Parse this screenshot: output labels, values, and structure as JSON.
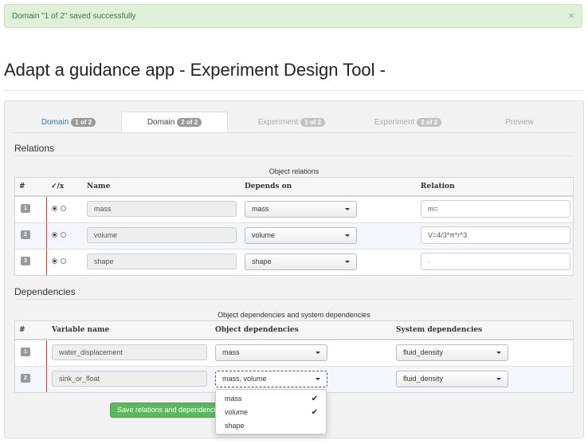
{
  "alert": {
    "message": "Domain \"1 of 2\" saved successfully",
    "close": "×"
  },
  "page": {
    "title": "Adapt a guidance app - Experiment Design Tool -"
  },
  "tabs": [
    {
      "label": "Domain",
      "badge": "1 of 2"
    },
    {
      "label": "Domain",
      "badge": "2 of 2"
    },
    {
      "label": "Experiment",
      "badge": "1 of 2"
    },
    {
      "label": "Experiment",
      "badge": "2 of 2"
    },
    {
      "label": "Preview"
    }
  ],
  "relations": {
    "section_title": "Relations",
    "caption": "Object relations",
    "headers": [
      "#",
      "✓/x",
      "Name",
      "Depends on",
      "Relation"
    ],
    "rows": [
      {
        "index": "1",
        "checked": true,
        "name": "mass",
        "depends_on": "mass",
        "relation": "m="
      },
      {
        "index": "2",
        "checked": true,
        "name": "volume",
        "depends_on": "volume",
        "relation": "V=4/3*π*r^3"
      },
      {
        "index": "3",
        "checked": true,
        "name": "shape",
        "depends_on": "shape",
        "relation": "-"
      }
    ]
  },
  "dependencies": {
    "section_title": "Dependencies",
    "caption": "Object dependencies and system dependencies",
    "headers": [
      "#",
      "Variable name",
      "Object dependencies",
      "System dependencies"
    ],
    "rows": [
      {
        "index": "1",
        "variable": "water_displacement",
        "object_deps": "mass",
        "system_deps": "fluid_density"
      },
      {
        "index": "2",
        "variable": "sink_or_float",
        "object_deps": "mass, volume",
        "system_deps": "fluid_density"
      }
    ]
  },
  "save_button": {
    "label": "Save relations and dependencies"
  },
  "dropdown": {
    "options": [
      {
        "label": "mass",
        "checked": true,
        "mark": "✔"
      },
      {
        "label": "volume",
        "checked": true,
        "mark": "✔"
      },
      {
        "label": "shape",
        "checked": false,
        "mark": ""
      }
    ]
  },
  "colors": {
    "success_bg": "#dff0d8",
    "success_text": "#3c763d",
    "primary_button": "#5cb85c",
    "link": "#337ab7"
  }
}
